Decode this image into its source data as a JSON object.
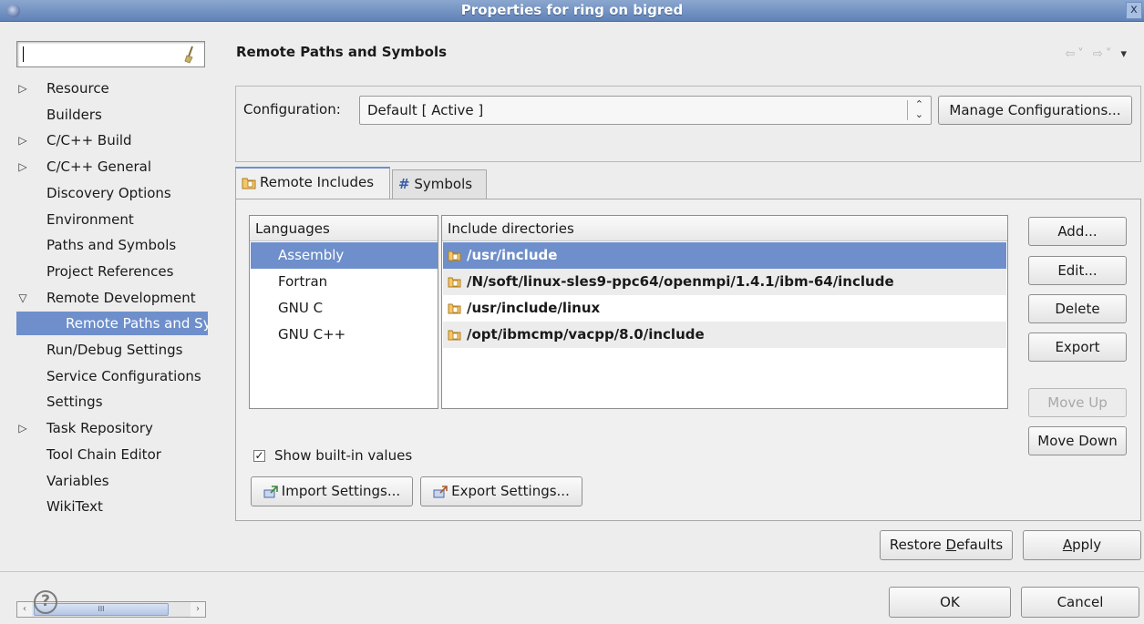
{
  "window": {
    "title": "Properties for ring on bigred",
    "close_glyph": "x"
  },
  "sidebar": {
    "filter_placeholder": "",
    "items": [
      {
        "label": "Resource",
        "expand": "▷",
        "level": 0,
        "selected": false
      },
      {
        "label": "Builders",
        "expand": "",
        "level": 0,
        "selected": false
      },
      {
        "label": "C/C++ Build",
        "expand": "▷",
        "level": 0,
        "selected": false
      },
      {
        "label": "C/C++ General",
        "expand": "▷",
        "level": 0,
        "selected": false
      },
      {
        "label": "Discovery Options",
        "expand": "",
        "level": 0,
        "selected": false
      },
      {
        "label": "Environment",
        "expand": "",
        "level": 0,
        "selected": false
      },
      {
        "label": "Paths and Symbols",
        "expand": "",
        "level": 0,
        "selected": false
      },
      {
        "label": "Project References",
        "expand": "",
        "level": 0,
        "selected": false
      },
      {
        "label": "Remote Development",
        "expand": "▽",
        "level": 0,
        "selected": false
      },
      {
        "label": "Remote Paths and Symbols",
        "expand": "",
        "level": 1,
        "selected": true
      },
      {
        "label": "Run/Debug Settings",
        "expand": "",
        "level": 0,
        "selected": false
      },
      {
        "label": "Service Configurations",
        "expand": "",
        "level": 0,
        "selected": false
      },
      {
        "label": "Settings",
        "expand": "",
        "level": 0,
        "selected": false
      },
      {
        "label": "Task Repository",
        "expand": "▷",
        "level": 0,
        "selected": false
      },
      {
        "label": "Tool Chain Editor",
        "expand": "",
        "level": 0,
        "selected": false
      },
      {
        "label": "Variables",
        "expand": "",
        "level": 0,
        "selected": false
      },
      {
        "label": "WikiText",
        "expand": "",
        "level": 0,
        "selected": false
      }
    ],
    "scroll_thumb_glyph": "III"
  },
  "page": {
    "title": "Remote Paths and Symbols",
    "back_glyph": "⇦˅",
    "forward_glyph": "⇨˅",
    "menu_glyph": "▾"
  },
  "config": {
    "label": "Configuration:",
    "value": "Default [ Active ]",
    "manage_button": "Manage Configurations..."
  },
  "tabs": [
    {
      "label": "Remote Includes",
      "active": true
    },
    {
      "label": "Symbols",
      "active": false,
      "prefix": "#"
    }
  ],
  "languages": {
    "header": "Languages",
    "items": [
      "Assembly",
      "Fortran",
      "GNU C",
      "GNU C++"
    ],
    "selected_index": 0
  },
  "directories": {
    "header": "Include directories",
    "rows": [
      "/usr/include",
      "/N/soft/linux-sles9-ppc64/openmpi/1.4.1/ibm-64/include",
      "/usr/include/linux",
      "/opt/ibmcmp/vacpp/8.0/include"
    ],
    "selected_index": 0
  },
  "side_buttons": {
    "add": "Add...",
    "edit": "Edit...",
    "delete": "Delete",
    "export": "Export",
    "move_up": "Move Up",
    "move_down": "Move Down"
  },
  "show_builtin": {
    "label": "Show built-in values",
    "checked": true,
    "check_glyph": "✓"
  },
  "import_settings": "Import Settings...",
  "export_settings": "Export Settings...",
  "restore_defaults": {
    "before": "Restore ",
    "mnemonic": "D",
    "after": "efaults"
  },
  "apply": {
    "mnemonic": "A",
    "after": "pply"
  },
  "ok": "OK",
  "cancel": "Cancel",
  "help_glyph": "?",
  "colors": {
    "selection": "#6e8fcb",
    "title_bar": "#5f82b8",
    "window_bg": "#ededed"
  }
}
